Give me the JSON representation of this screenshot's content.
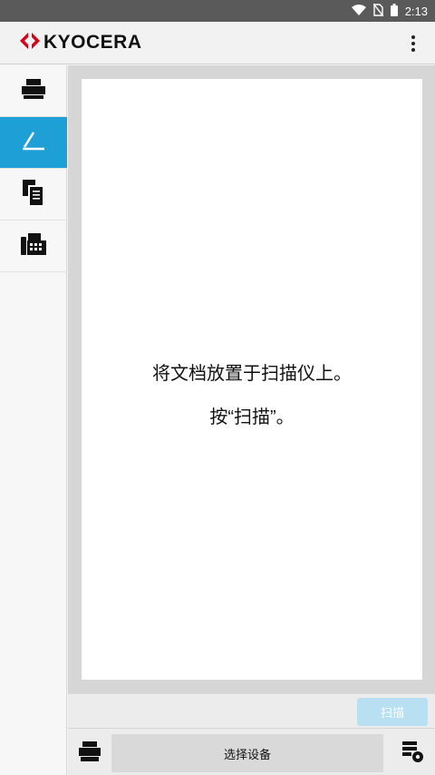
{
  "status_bar": {
    "time": "2:13",
    "icons": [
      "wifi-icon",
      "no-sim-icon",
      "battery-icon"
    ]
  },
  "app_bar": {
    "logo_text": "KYOCERA",
    "logo_icon": "kyocera-logo-icon",
    "menu_icon": "overflow-menu-icon"
  },
  "sidebar": {
    "items": [
      {
        "name": "print",
        "icon": "printer-icon",
        "active": false
      },
      {
        "name": "scan",
        "icon": "scanner-icon",
        "active": true
      },
      {
        "name": "copy",
        "icon": "copy-icon",
        "active": false
      },
      {
        "name": "fax",
        "icon": "fax-icon",
        "active": false
      }
    ]
  },
  "main": {
    "instruction_line1": "将文档放置于扫描仪上。",
    "instruction_line2": "按“扫描”。"
  },
  "actions": {
    "scan_label": "扫描"
  },
  "device_bar": {
    "select_label": "选择设备",
    "device_icon": "printer-icon",
    "settings_icon": "device-settings-icon"
  },
  "colors": {
    "accent": "#1ea0d6",
    "scan_button_disabled": "#b8dff2",
    "status_bar": "#5a5a5a",
    "logo_red": "#d6001c"
  }
}
